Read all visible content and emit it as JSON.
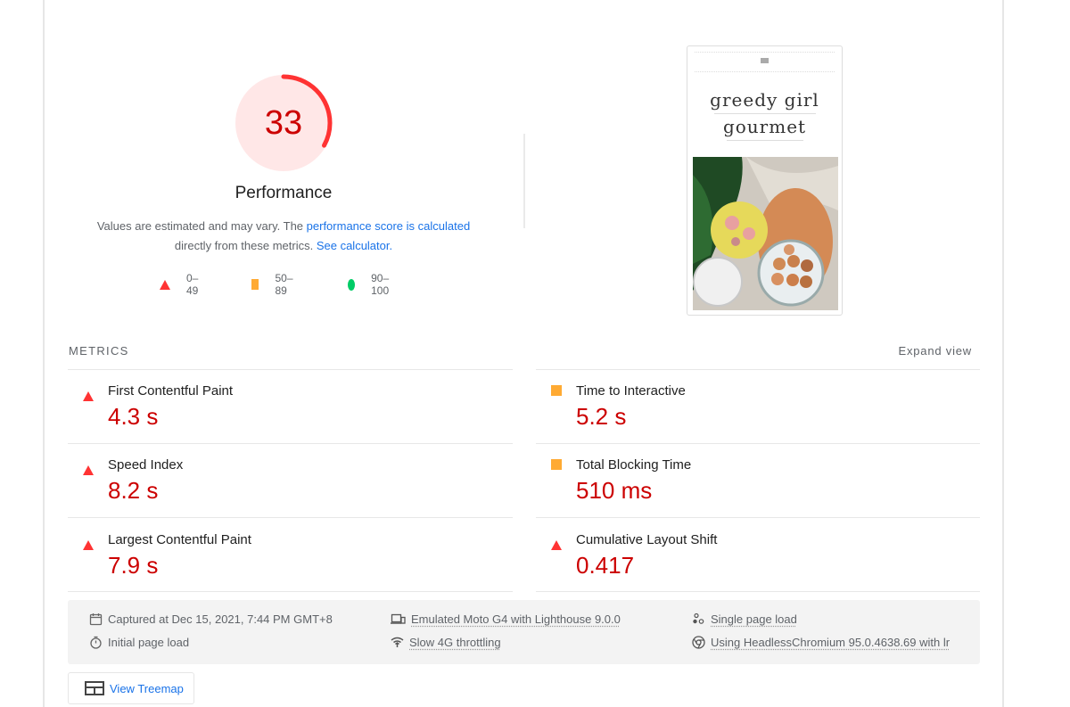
{
  "gauge": {
    "score": 33,
    "score_label": "33",
    "fraction": 0.33,
    "title": "Performance",
    "color": "#ff3333",
    "bg_color": "#ffe7e7",
    "text_color": "#cc0000"
  },
  "description": {
    "prefix": "Values are estimated and may vary. The ",
    "link1": "performance score is calculated",
    "middle": " directly from these metrics. ",
    "link2": "See calculator."
  },
  "legend": [
    {
      "shape": "triangle-icon",
      "label": "0–49",
      "color": "#ff3333"
    },
    {
      "shape": "square-icon",
      "label": "50–89",
      "color": "#ffaa33"
    },
    {
      "shape": "circle-icon",
      "label": "90–100",
      "color": "#00cc66"
    }
  ],
  "screenshot": {
    "brand_line1": "greedy girl",
    "brand_line2": "gourmet"
  },
  "metrics": {
    "section_label": "METRICS",
    "expand_label": "Expand view",
    "items": [
      {
        "name": "First Contentful Paint",
        "value": "4.3 s",
        "rating": "fail"
      },
      {
        "name": "Time to Interactive",
        "value": "5.2 s",
        "rating": "average"
      },
      {
        "name": "Speed Index",
        "value": "8.2 s",
        "rating": "fail"
      },
      {
        "name": "Total Blocking Time",
        "value": "510 ms",
        "rating": "average"
      },
      {
        "name": "Largest Contentful Paint",
        "value": "7.9 s",
        "rating": "fail"
      },
      {
        "name": "Cumulative Layout Shift",
        "value": "0.417",
        "rating": "fail"
      }
    ]
  },
  "environment": {
    "captured": "Captured at Dec 15, 2021, 7:44 PM GMT+8",
    "initial_load": "Initial page load",
    "device": "Emulated Moto G4 with Lighthouse 9.0.0",
    "throttling": "Slow 4G throttling",
    "single_load": "Single page load",
    "browser": "Using HeadlessChromium 95.0.4638.69 with lr"
  },
  "treemap_button": "View Treemap"
}
